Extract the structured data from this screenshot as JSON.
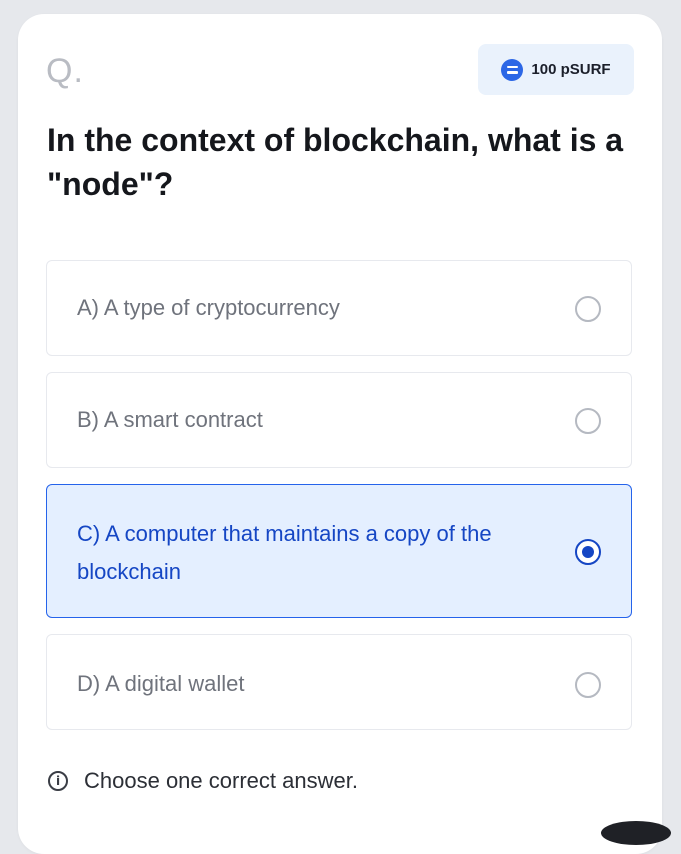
{
  "header": {
    "question_marker": "Q.",
    "reward": {
      "icon": "coin-icon",
      "text": "100 pSURF",
      "color": "#2c67e6"
    }
  },
  "question": {
    "text": "In the context of blockchain, what is a \"node\"?"
  },
  "options": [
    {
      "label": "A) A type of cryptocurrency",
      "selected": false
    },
    {
      "label": "B) A smart contract",
      "selected": false
    },
    {
      "label": "C) A computer that maintains a copy of the blockchain",
      "selected": true
    },
    {
      "label": "D) A digital wallet",
      "selected": false
    }
  ],
  "footer": {
    "icon": "info-icon",
    "text": "Choose one correct answer."
  },
  "colors": {
    "accent": "#1546c4",
    "selected_bg": "#e4efff"
  }
}
